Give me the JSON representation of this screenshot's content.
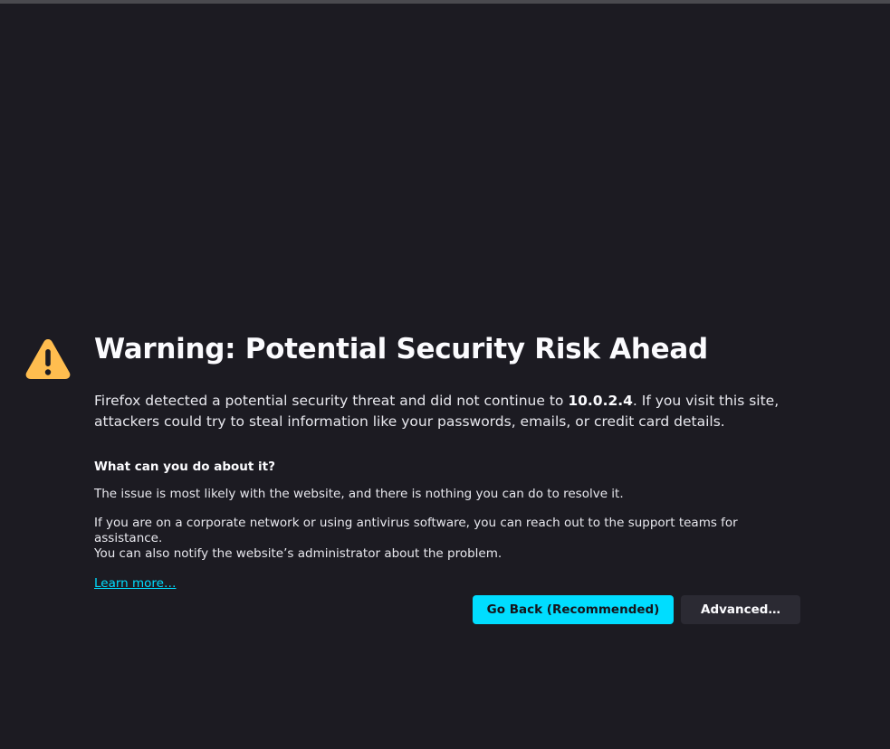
{
  "page": {
    "title": "Warning: Potential Security Risk Ahead",
    "intro_before": "Firefox detected a potential security threat and did not continue to ",
    "host": "10.0.2.4",
    "intro_after": ". If you visit this site, attackers could try to steal information like your passwords, emails, or credit card details.",
    "what_heading": "What can you do about it?",
    "para1": "The issue is most likely with the website, and there is nothing you can do to resolve it.",
    "para2_line1": "If you are on a corporate network or using antivirus software, you can reach out to the support teams for assistance.",
    "para2_line2": "You can also notify the website’s administrator about the problem.",
    "learn_more": "Learn more…"
  },
  "buttons": {
    "go_back": "Go Back (Recommended)",
    "advanced": "Advanced…"
  },
  "icons": {
    "warning": "warning-triangle-icon"
  },
  "colors": {
    "background": "#1c1b22",
    "accent": "#00ddff",
    "warning": "#ffbd4f",
    "secondary_button": "#2b2a33"
  }
}
